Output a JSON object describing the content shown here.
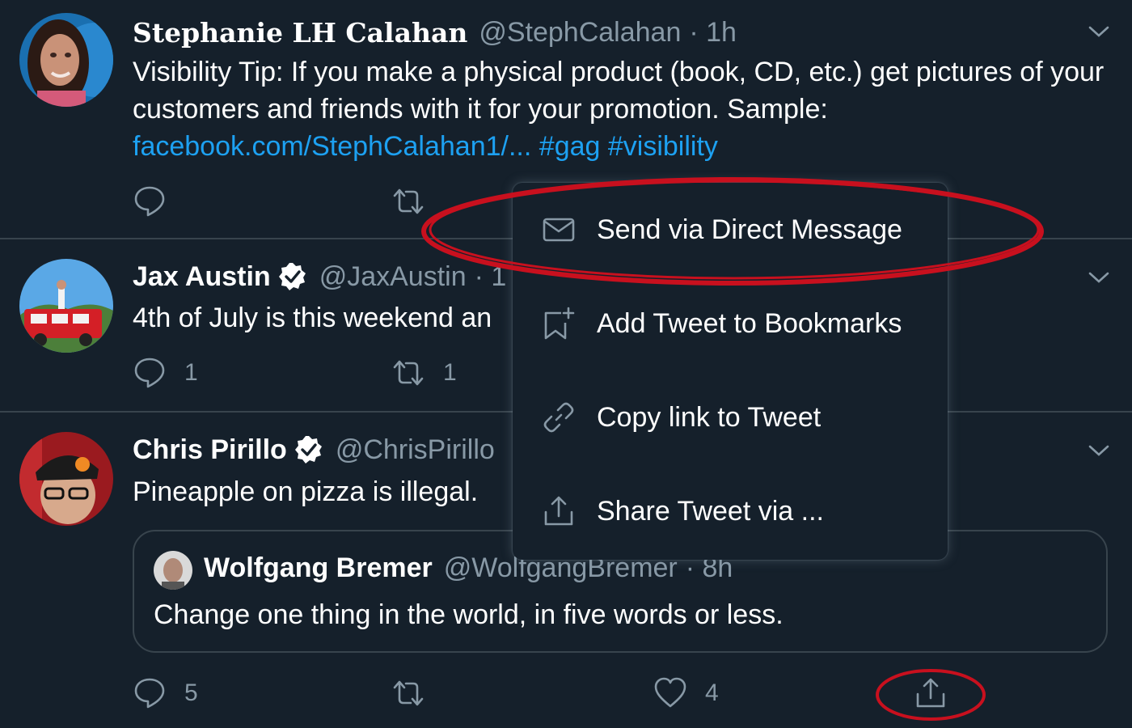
{
  "tweets": [
    {
      "name": "Stephanie LH Calahan",
      "handle": "@StephCalahan",
      "time": "· 1h",
      "text": "Visibility Tip: If you make a physical product (book, CD, etc.) get pictures of your customers and friends with it for your promotion. Sample:",
      "link": "facebook.com/StephCalahan1/...",
      "tag1": "#gag",
      "tag2": "#visibility"
    },
    {
      "name": "Jax Austin",
      "handle": "@JaxAustin",
      "time": "· 1",
      "text": "4th of July is this weekend an",
      "reply_count": "1",
      "retweet_count": "1"
    },
    {
      "name": "Chris Pirillo",
      "handle": "@ChrisPirillo",
      "text": "Pineapple on pizza is illegal.",
      "reply_count": "5",
      "like_count": "4",
      "quoted": {
        "name": "Wolfgang Bremer",
        "handle": "@WolfgangBremer",
        "time": "· 8h",
        "text": "Change one thing in the world, in five words or less."
      }
    }
  ],
  "menu": {
    "items": [
      {
        "label": "Send via Direct Message",
        "icon": "envelope-icon"
      },
      {
        "label": "Add Tweet to Bookmarks",
        "icon": "bookmark-add-icon"
      },
      {
        "label": "Copy link to Tweet",
        "icon": "link-icon"
      },
      {
        "label": "Share Tweet via ...",
        "icon": "share-icon"
      }
    ]
  },
  "colors": {
    "background": "#15202b",
    "border": "#38444d",
    "secondary_text": "#8899a6",
    "link": "#1da1f2",
    "annotation": "#c8101e"
  }
}
